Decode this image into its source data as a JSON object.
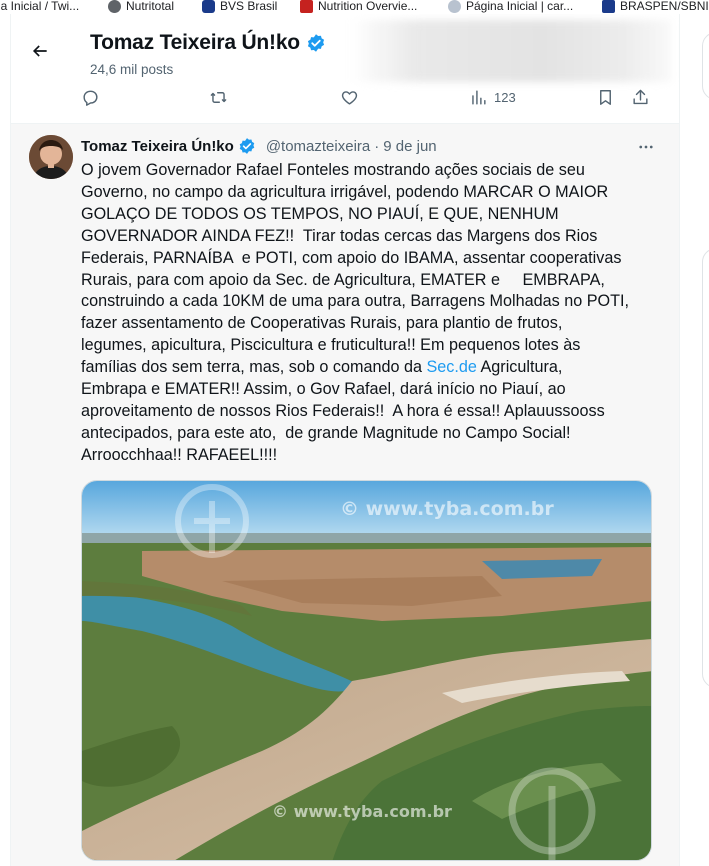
{
  "bookmarks": [
    {
      "label": "na Inicial / Twi...",
      "icon": "twitter-icon",
      "color": "#1d9bf0"
    },
    {
      "label": "Nutritotal",
      "icon": "globe-icon",
      "color": "#5f6368"
    },
    {
      "label": "BVS Brasil",
      "icon": "bvs-icon",
      "color": "#1a3a8a"
    },
    {
      "label": "Nutrition Overvie...",
      "icon": "nutrition-icon",
      "color": "#c5221f"
    },
    {
      "label": "Página Inicial | car...",
      "icon": "shield-icon",
      "color": "#7a8aa0"
    },
    {
      "label": "BRASPEN/SBNI",
      "icon": "braspen-icon",
      "color": "#1a3a8a"
    }
  ],
  "header": {
    "name": "Tomaz Teixeira Ún!ko",
    "posts_count": "24,6 mil posts",
    "verified": true
  },
  "top_actions": {
    "views_count": "123"
  },
  "tweet": {
    "author_name": "Tomaz Teixeira Ún!ko",
    "handle": "@tomazteixeira",
    "separator": "·",
    "date": "9 de jun",
    "text_before_link": "O jovem Governador Rafael Fonteles mostrando ações sociais de seu\nGoverno, no campo da agricultura irrigável, podendo MARCAR O MAIOR\nGOLAÇO DE TODOS OS TEMPOS, NO PIAUÍ, E QUE, NENHUM\nGOVERNADOR AINDA FEZ!!  Tirar todas cercas das Margens dos Rios\nFederais, PARNAÍBA  e POTI, com apoio do IBAMA, assentar cooperativas\nRurais, para com apoio da Sec. de Agricultura, EMATER e     EMBRAPA,\nconstruindo a cada 10KM de uma para outra, Barragens Molhadas no POTI,\nfazer assentamento de Cooperativas Rurais, para plantio de frutos,\nlegumes, apicultura, Piscicultura e fruticultura!! Em pequenos lotes às\nfamílias dos sem terra, mas, sob o comando da ",
    "link_text": "Sec.de",
    "text_after_link": " Agricultura,\nEmbrapa e EMATER!! Assim, o Gov Rafael, dará início no Piauí, ao\naproveitamento de nossos Rios Federais!!  A hora é essa!! Aplauussooss\nantecipados, para este ato,  de grande Magnitude no Campo Social!\nArroocchhaa!! RAFAEEL!!!!",
    "image_watermark": "© www.tyba.com.br",
    "image_watermark_bottom": "© www.tyba.com.br"
  },
  "colors": {
    "accent": "#1d9bf0",
    "secondary_text": "#536471",
    "tweet_bg": "#f7f7f7"
  }
}
